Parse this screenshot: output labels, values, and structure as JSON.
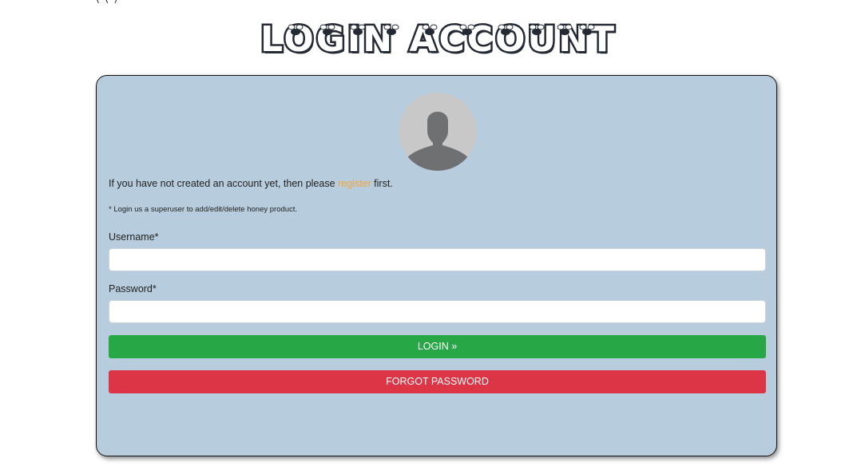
{
  "top_fragment": "(                    (    )",
  "title": "LOGIN ACCOUNT",
  "card": {
    "info_before": "If you have not created an account yet, then please ",
    "info_link": "register",
    "info_after": " first.",
    "note": "* Login us a superuser to add/edit/delete honey product.",
    "username_label": "Username*",
    "username_value": "",
    "password_label": "Password*",
    "password_value": "",
    "login_label": "LOGIN »",
    "forgot_label": "FORGOT PASSWORD"
  },
  "icons": {
    "avatar": "default-user-avatar-icon",
    "decoration": "bee-icon"
  },
  "colors": {
    "card_bg": "#b7ccdd",
    "link": "#f0a73a",
    "login_button": "#27a745",
    "forgot_button": "#dc3545",
    "title_outline": "#242a33"
  }
}
